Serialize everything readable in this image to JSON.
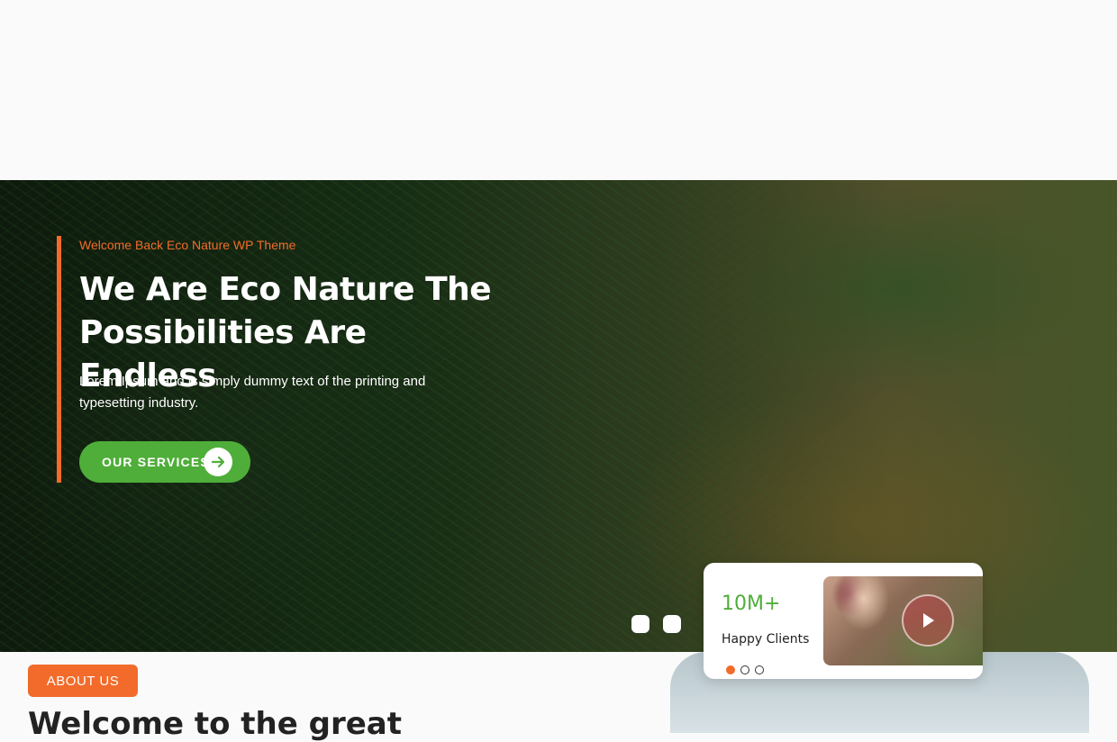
{
  "hero": {
    "eyebrow": "Welcome Back Eco Nature WP Theme",
    "title": "We Are Eco Nature The Possibilities Are Endless",
    "description": "Lorem Ipsum and is simply dummy text of the printing and typesetting industry.",
    "cta_label": "OUR SERVICES",
    "cta_icon": "arrow-right-icon",
    "slider_dots": 2
  },
  "stats_card": {
    "value": "10M+",
    "label": "Happy Clients",
    "dots": [
      true,
      false,
      false
    ],
    "video_icon": "play-icon"
  },
  "about": {
    "badge": "ABOUT US",
    "heading": "Welcome to the great"
  },
  "colors": {
    "accent": "#f26b2a",
    "brand_green": "#4fae3a"
  }
}
